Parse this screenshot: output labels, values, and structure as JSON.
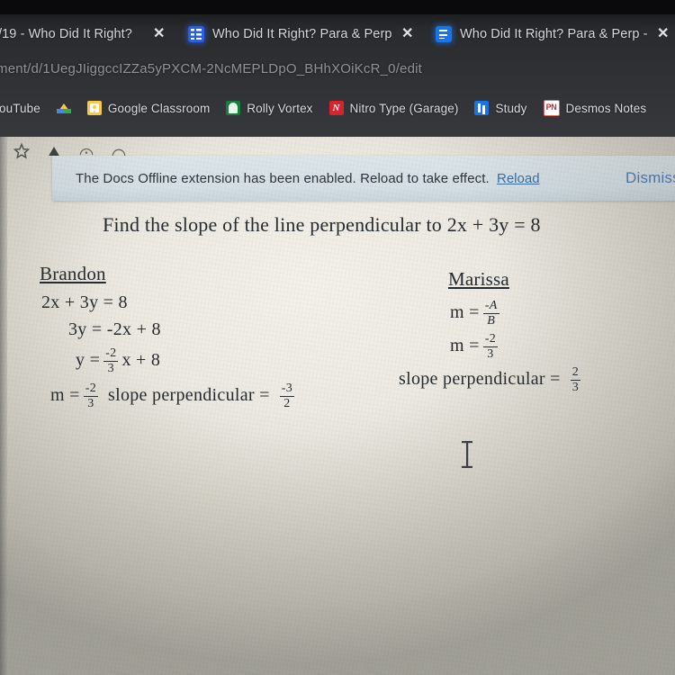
{
  "browser": {
    "tabs": [
      {
        "title": "/19 - Who Did It Right?",
        "favicon": "none",
        "close_label": "✕",
        "active": false
      },
      {
        "title": "Who Did It Right? Para & Perp",
        "favicon": "google-sheets-icon",
        "close_label": "✕",
        "active": false
      },
      {
        "title": "Who Did It Right? Para & Perp -",
        "favicon": "google-docs-icon",
        "close_label": "✕",
        "active": true
      }
    ],
    "omnibox": {
      "url": "ment/d/1UegJIiggccIZZa5yPXCM-2NcMEPLDpO_BHhXOiKcR_0/edit"
    },
    "bookmarks": [
      {
        "label": "ouTube",
        "icon": "youtube-icon"
      },
      {
        "label": "",
        "icon": "google-drive-icon"
      },
      {
        "label": "Google Classroom",
        "icon": "google-classroom-icon"
      },
      {
        "label": "Rolly Vortex",
        "icon": "rolly-vortex-icon"
      },
      {
        "label": "Nitro Type (Garage)",
        "icon": "nitro-type-icon",
        "glyph": "N"
      },
      {
        "label": "Study",
        "icon": "study-icon"
      },
      {
        "label": "Desmos Notes",
        "icon": "desmos-notes-icon",
        "glyph": "PN"
      }
    ],
    "toolbar_icons": [
      "star-icon",
      "drive-upload-icon",
      "extension-icon",
      "profile-icon"
    ]
  },
  "notification": {
    "message": "The Docs Offline extension has been enabled. Reload to take effect.",
    "reload_label": "Reload",
    "dismiss_label": "Dismiss"
  },
  "document": {
    "question": "Find the slope of the line perpendicular  to 2x + 3y = 8",
    "brandon": {
      "name": "Brandon",
      "step1": "2x + 3y = 8",
      "step2": "3y = -2x + 8",
      "step3_prefix": "y  =",
      "step3_frac_num": "-2",
      "step3_frac_den": "3",
      "step3_suffix": "x  +  8",
      "step4_prefix": "m =",
      "step4_frac_num": "-2",
      "step4_frac_den": "3",
      "step4_mid": "slope perpendicular  =",
      "step4_ans_num": "-3",
      "step4_ans_den": "2"
    },
    "marissa": {
      "name": "Marissa",
      "step1_prefix": "m  =",
      "step1_frac_num": "-A",
      "step1_frac_den": "B",
      "step2_prefix": "m  =",
      "step2_frac_num": "-2",
      "step2_frac_den": "3",
      "step3_prefix": "slope perpendicular  =",
      "step3_ans_num": "2",
      "step3_ans_den": "3"
    }
  },
  "colors": {
    "chrome_bg": "#303134",
    "page_bg": "#eceae2",
    "notif_bg": "#d5e0e5",
    "link_blue": "#3a6ea8",
    "docs_blue": "#1a73e8",
    "text": "#262b2f"
  }
}
